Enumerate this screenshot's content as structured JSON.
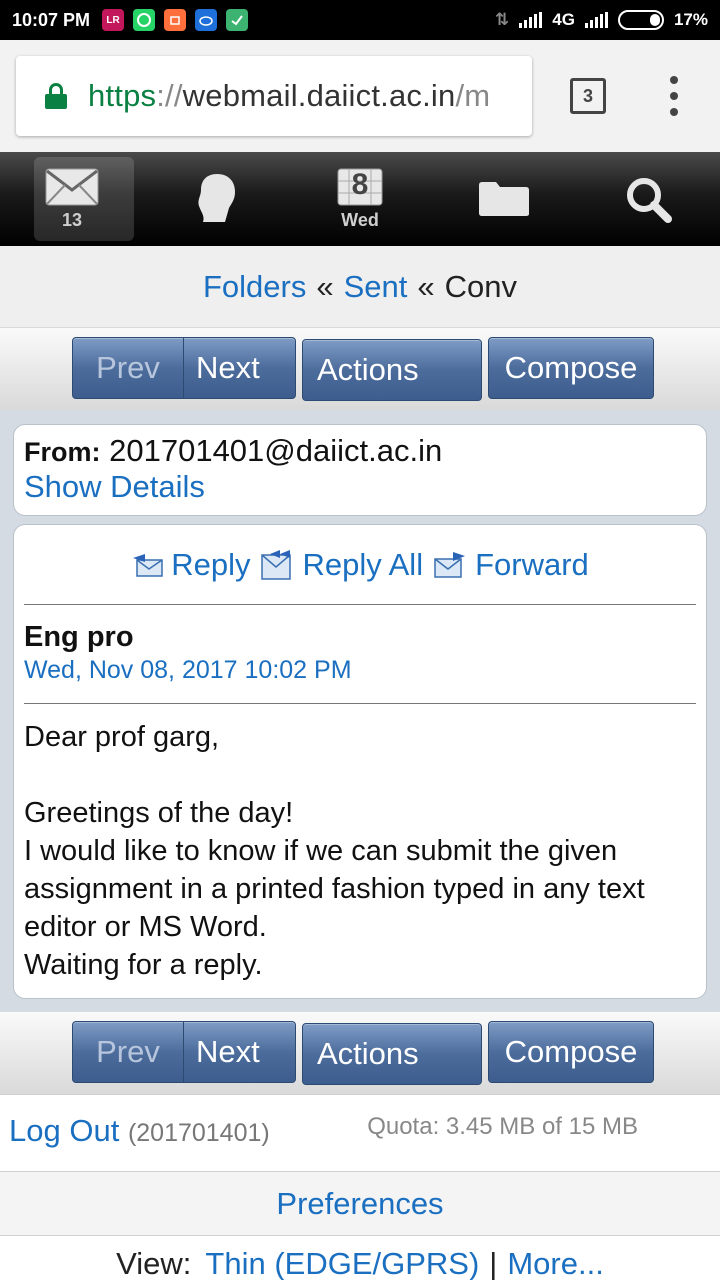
{
  "status_bar": {
    "time": "10:07 PM",
    "apps": [
      {
        "icon": "lr-app-icon",
        "text": "LR",
        "color": "#c2185b"
      },
      {
        "icon": "whatsapp-icon",
        "text": "",
        "color": "#25d366"
      },
      {
        "icon": "mi-store-icon",
        "text": "",
        "color": "#ff6f3c"
      },
      {
        "icon": "cloud-icon",
        "text": "",
        "color": "#1e6fd9"
      },
      {
        "icon": "wechat-icon",
        "text": "",
        "color": "#3cb371"
      }
    ],
    "network": "4G",
    "battery": "17%"
  },
  "browser": {
    "url_scheme": "https",
    "url_sep": "://",
    "url_host": "webmail.daiict.ac.in",
    "url_path": "/m",
    "tab_count": "3"
  },
  "toolbar": {
    "mail_count": "13",
    "calendar_day_number": "8",
    "calendar_label": "Wed"
  },
  "breadcrumb": {
    "folders": "Folders",
    "sep1": "«",
    "sent": "Sent",
    "sep2": "«",
    "current": "Conv"
  },
  "nav": {
    "prev": "Prev",
    "next": "Next",
    "actions": "Actions",
    "compose": "Compose"
  },
  "message": {
    "from_label": "From:",
    "from_address": "201701401@daiict.ac.in",
    "show_details": "Show Details",
    "reply": "Reply",
    "reply_all": "Reply All",
    "forward": "Forward",
    "subject": "Eng pro",
    "date": "Wed, Nov 08, 2017 10:02 PM",
    "body": "Dear prof garg,\n\nGreetings of the day!\nI would like to know if we can submit the given assignment in a printed fashion typed in any text editor or MS Word.\nWaiting for a reply."
  },
  "footer": {
    "logout": "Log Out",
    "user_id": "(201701401)",
    "quota": "Quota: 3.45 MB of 15 MB",
    "preferences": "Preferences",
    "view_label": "View:",
    "view_thin": "Thin (EDGE/GPRS)",
    "view_sep": "|",
    "view_more": "More..."
  },
  "colors": {
    "link": "#1a6fc1",
    "secure_green": "#0b8043",
    "button_blue": "#4c6c9c"
  }
}
